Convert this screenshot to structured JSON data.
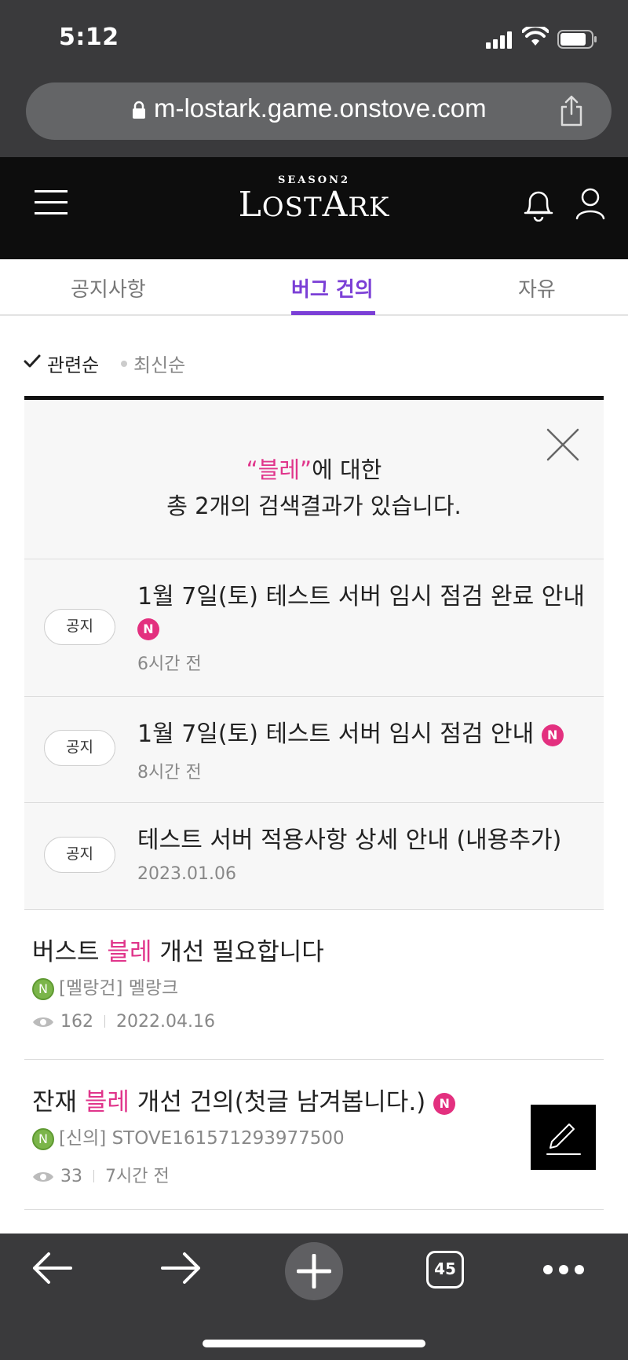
{
  "status_bar": {
    "time": "5:12"
  },
  "browser": {
    "url": "m-lostark.game.onstove.com",
    "tab_count": "45"
  },
  "site_header": {
    "logo_season": "SEASON2",
    "logo_name_1": "L",
    "logo_name_2": "OST",
    "logo_name_3": "A",
    "logo_name_4": "RK"
  },
  "tabs": [
    {
      "label": "공지사항",
      "active": false
    },
    {
      "label": "버그 건의",
      "active": true
    },
    {
      "label": "자유",
      "active": false
    }
  ],
  "sort": {
    "selected": "관련순",
    "other": "최신순"
  },
  "results": {
    "keyword": "“블레”",
    "suffix": "에 대한",
    "summary": "총 2개의 검색결과가 있습니다."
  },
  "notices": [
    {
      "badge": "공지",
      "title": "1월 7일(토) 테스트 서버 임시 점검 완료 안내",
      "new": "N",
      "meta": "6시간 전"
    },
    {
      "badge": "공지",
      "title": "1월 7일(토) 테스트 서버 임시 점검 안내",
      "new": "N",
      "meta": "8시간 전"
    },
    {
      "badge": "공지",
      "title": "테스트 서버 적용사항 상세 안내 (내용추가)",
      "meta": "2023.01.06"
    }
  ],
  "posts": [
    {
      "title_pre": "버스트 ",
      "title_kw": "블레",
      "title_post": " 개선 필요합니다",
      "level_badge": "N",
      "author": "[멜랑건] 멜랑크",
      "views": "162",
      "date": "2022.04.16"
    },
    {
      "title_pre": "잔재 ",
      "title_kw": "블레",
      "title_post": " 개선 건의(첫글 남겨봅니다.) ",
      "new": "N",
      "level_badge": "N",
      "author": "[신의] STOVE161571293977500",
      "views": "33",
      "date": "7시간 전"
    }
  ],
  "colors": {
    "accent_purple": "#7b3fd6",
    "keyword_pink": "#e0358b",
    "new_badge": "#e3307f",
    "level_badge": "#7bb54a",
    "browser_chrome": "#3a3a3c"
  }
}
